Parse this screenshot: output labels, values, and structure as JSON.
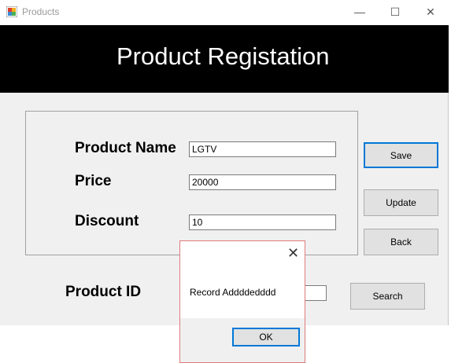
{
  "window": {
    "title": "Products",
    "controls": {
      "minimize": "—",
      "maximize": "☐",
      "close": "✕"
    }
  },
  "banner": {
    "title": "Product Registation"
  },
  "form": {
    "product_name_label": "Product Name",
    "product_name_value": "LGTV",
    "price_label": "Price",
    "price_value": "20000",
    "discount_label": "Discount",
    "discount_value": "10",
    "product_id_label": "Product ID",
    "product_id_value": ""
  },
  "buttons": {
    "save": "Save",
    "update": "Update",
    "back": "Back",
    "search": "Search"
  },
  "dialog": {
    "message": "Record Addddedddd",
    "ok": "OK",
    "close": "✕"
  },
  "colors": {
    "banner_bg": "#000000",
    "banner_text": "#ffffff",
    "focus_border": "#0078d7",
    "dialog_border": "#e07a7a"
  }
}
